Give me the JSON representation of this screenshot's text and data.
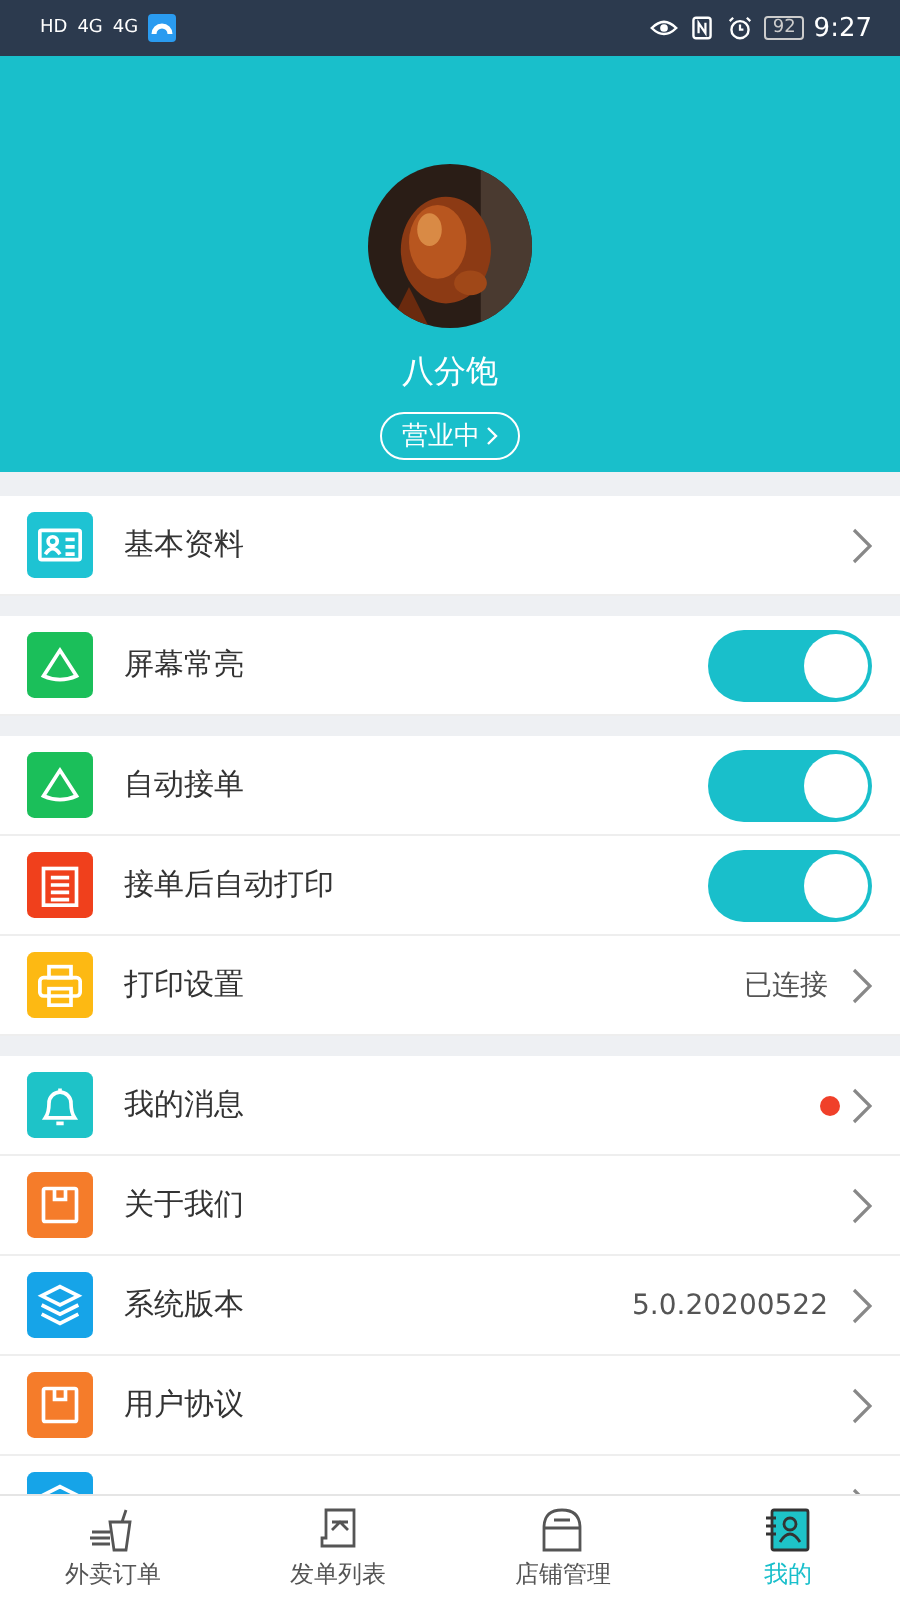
{
  "status_bar": {
    "left": [
      "HD",
      "4G",
      "4G"
    ],
    "battery": "92",
    "time": "9:27"
  },
  "profile": {
    "name": "八分饱",
    "status": "营业中"
  },
  "groups": [
    {
      "rows": [
        {
          "kind": "link",
          "label": "基本资料",
          "color": "#1ec3d3"
        }
      ]
    },
    {
      "rows": [
        {
          "kind": "toggle",
          "label": "屏幕常亮",
          "color": "#1bbf5a",
          "on": true
        }
      ]
    },
    {
      "rows": [
        {
          "kind": "toggle",
          "label": "自动接单",
          "color": "#1bbf5a",
          "on": true
        },
        {
          "kind": "toggle",
          "label": "接单后自动打印",
          "color": "#f0401c",
          "on": true
        },
        {
          "kind": "link",
          "label": "打印设置",
          "color": "#fdb913",
          "value": "已连接"
        }
      ]
    },
    {
      "rows": [
        {
          "kind": "link",
          "label": "我的消息",
          "color": "#1ec3c8",
          "unread": true
        },
        {
          "kind": "link",
          "label": "关于我们",
          "color": "#f57c2a",
          "unread": false
        },
        {
          "kind": "link",
          "label": "系统版本",
          "color": "#16a4e8",
          "value": "5.0.20200522"
        },
        {
          "kind": "link",
          "label": "用户协议",
          "color": "#f57c2a",
          "unread": false
        },
        {
          "kind": "link",
          "color": "#16a4e8"
        }
      ]
    }
  ],
  "tabs": [
    {
      "label": "外卖订单",
      "selected": false
    },
    {
      "label": "发单列表",
      "selected": false
    },
    {
      "label": "店铺管理",
      "selected": false
    },
    {
      "label": "我的",
      "selected": true
    }
  ]
}
